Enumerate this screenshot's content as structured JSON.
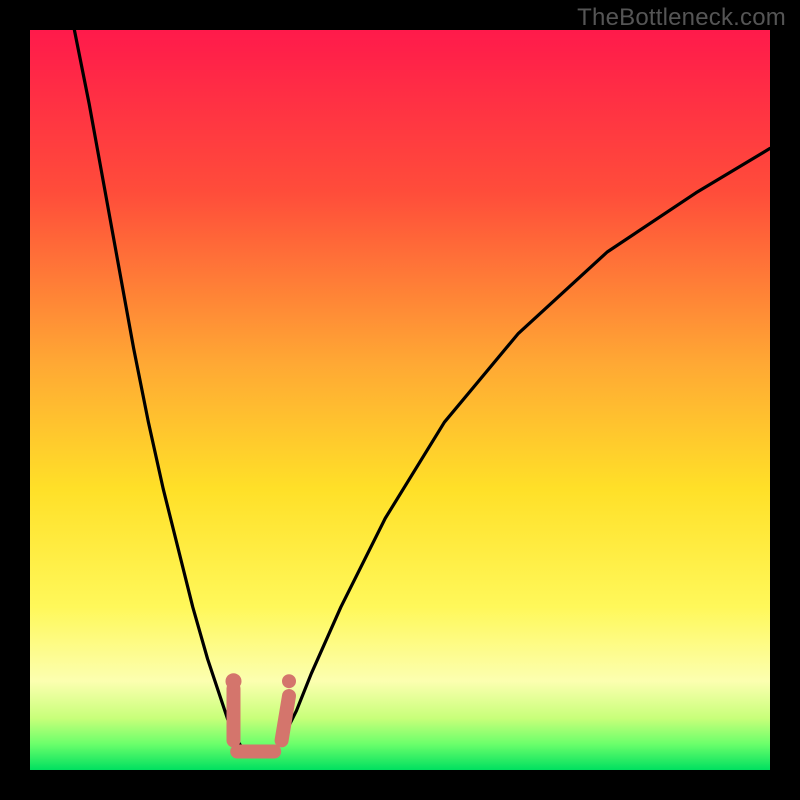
{
  "watermark": "TheBottleneck.com",
  "chart_data": {
    "type": "line",
    "title": "",
    "xlabel": "",
    "ylabel": "",
    "xlim": [
      0,
      100
    ],
    "ylim": [
      0,
      100
    ],
    "background": {
      "gradient_stops": [
        {
          "offset": 0.0,
          "color": "#ff1a4b"
        },
        {
          "offset": 0.22,
          "color": "#ff4d3a"
        },
        {
          "offset": 0.45,
          "color": "#ffa834"
        },
        {
          "offset": 0.62,
          "color": "#ffe028"
        },
        {
          "offset": 0.78,
          "color": "#fff85a"
        },
        {
          "offset": 0.88,
          "color": "#fcffb0"
        },
        {
          "offset": 0.93,
          "color": "#c8ff7a"
        },
        {
          "offset": 0.965,
          "color": "#6bff6b"
        },
        {
          "offset": 1.0,
          "color": "#00e060"
        }
      ]
    },
    "series": [
      {
        "name": "bottleneck-curve",
        "color": "#000000",
        "width": 3.2,
        "x": [
          6,
          8,
          10,
          12,
          14,
          16,
          18,
          20,
          22,
          24,
          26,
          27,
          28,
          29,
          30,
          31,
          32,
          33,
          34,
          36,
          38,
          42,
          48,
          56,
          66,
          78,
          90,
          100
        ],
        "y": [
          100,
          90,
          79,
          68,
          57,
          47,
          38,
          30,
          22,
          15,
          9,
          6,
          4,
          2.5,
          2,
          2,
          2,
          2.5,
          4,
          8,
          13,
          22,
          34,
          47,
          59,
          70,
          78,
          84
        ]
      }
    ],
    "markers": [
      {
        "name": "valley-highlight",
        "color": "#d4756c",
        "width": 14,
        "segments": [
          {
            "x": [
              27.5,
              27.5
            ],
            "y": [
              11,
              4
            ]
          },
          {
            "x": [
              28,
              33
            ],
            "y": [
              2.5,
              2.5
            ]
          },
          {
            "x": [
              34,
              35
            ],
            "y": [
              4,
              10
            ]
          }
        ],
        "dots": [
          {
            "x": 27.5,
            "y": 12,
            "r": 8
          },
          {
            "x": 35,
            "y": 12,
            "r": 7
          }
        ]
      }
    ]
  }
}
